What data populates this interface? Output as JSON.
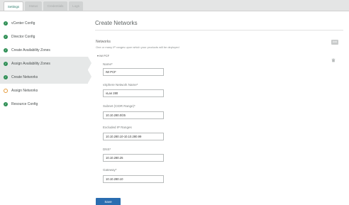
{
  "tabs": [
    {
      "label": "Settings",
      "active": true
    },
    {
      "label": "Status",
      "active": false
    },
    {
      "label": "Credentials",
      "active": false
    },
    {
      "label": "Logs",
      "active": false
    }
  ],
  "sidebar": {
    "items": [
      {
        "label": "vCenter Config",
        "state": "done",
        "selected": false
      },
      {
        "label": "Director Config",
        "state": "done",
        "selected": false
      },
      {
        "label": "Create Availability Zones",
        "state": "done",
        "selected": false
      },
      {
        "label": "Assign Availability Zones",
        "state": "done",
        "selected": true
      },
      {
        "label": "Create Networks",
        "state": "done",
        "selected": true
      },
      {
        "label": "Assign Networks",
        "state": "warn",
        "selected": false
      },
      {
        "label": "Resource Config",
        "state": "done",
        "selected": false
      }
    ]
  },
  "main": {
    "title": "Create Networks",
    "section_title": "Networks",
    "section_desc": "One or many IP ranges upon which your products will be deployed",
    "add_label": "Add",
    "collapse_label": "▾ IW PCF",
    "fields": [
      {
        "label": "Name*",
        "value": "IW PCF"
      },
      {
        "label": "vSphere Network Name*",
        "value": "vLan 280"
      },
      {
        "label": "Subnet (CIDR Range)*",
        "value": "10.10.280.0/25"
      },
      {
        "label": "Excluded IP Ranges",
        "value": "10.10.280.10-10.10.280.99"
      },
      {
        "label": "DNS*",
        "value": "10.10.280.25"
      },
      {
        "label": "Gateway*",
        "value": "10.10.280.10"
      }
    ],
    "save_label": "Save"
  },
  "colors": {
    "accent": "#2a6db0",
    "done": "#2f8f55",
    "warn": "#e59a3a"
  }
}
